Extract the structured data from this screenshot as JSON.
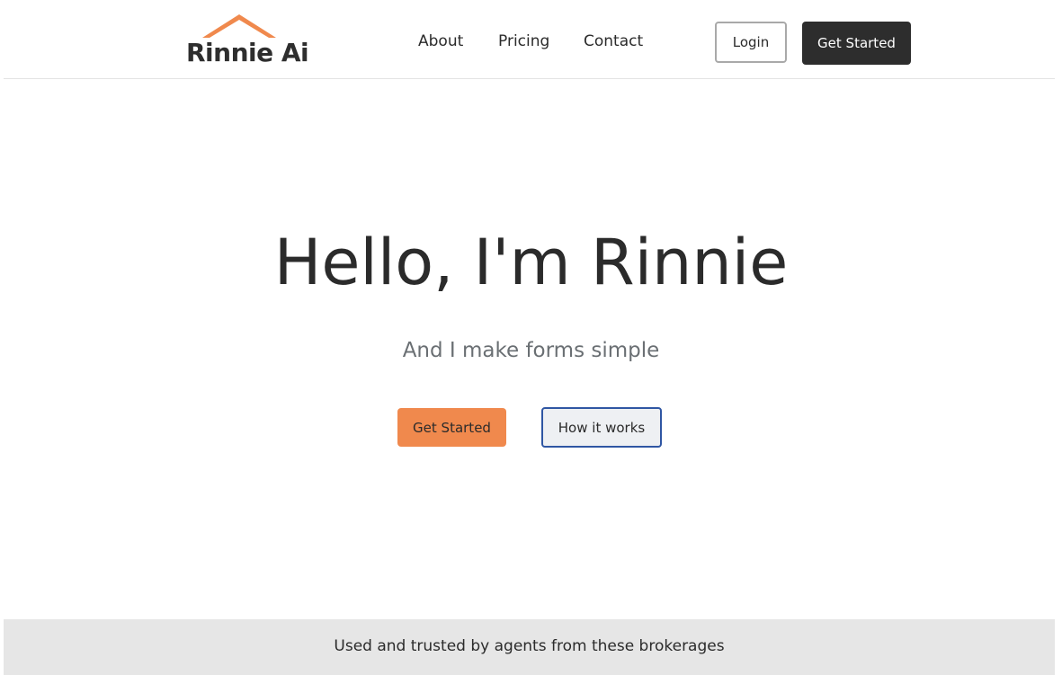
{
  "brand": {
    "name": "Rinnie Ai",
    "roof_color": "#f0894d"
  },
  "nav": {
    "links": [
      "About",
      "Pricing",
      "Contact"
    ],
    "login_label": "Login",
    "get_started_label": "Get Started"
  },
  "hero": {
    "title": "Hello, I'm Rinnie",
    "subtitle": "And I make forms simple",
    "primary_cta": "Get Started",
    "secondary_cta": "How it works"
  },
  "trust": {
    "text": "Used and trusted by agents from these brokerages"
  },
  "colors": {
    "accent": "#f0894d",
    "dark_button": "#2d2d2d",
    "outline_blue": "#2f56a3",
    "band_gray": "#e6e6e6"
  },
  "icons": {
    "logo_roof": "house-roof-icon"
  }
}
